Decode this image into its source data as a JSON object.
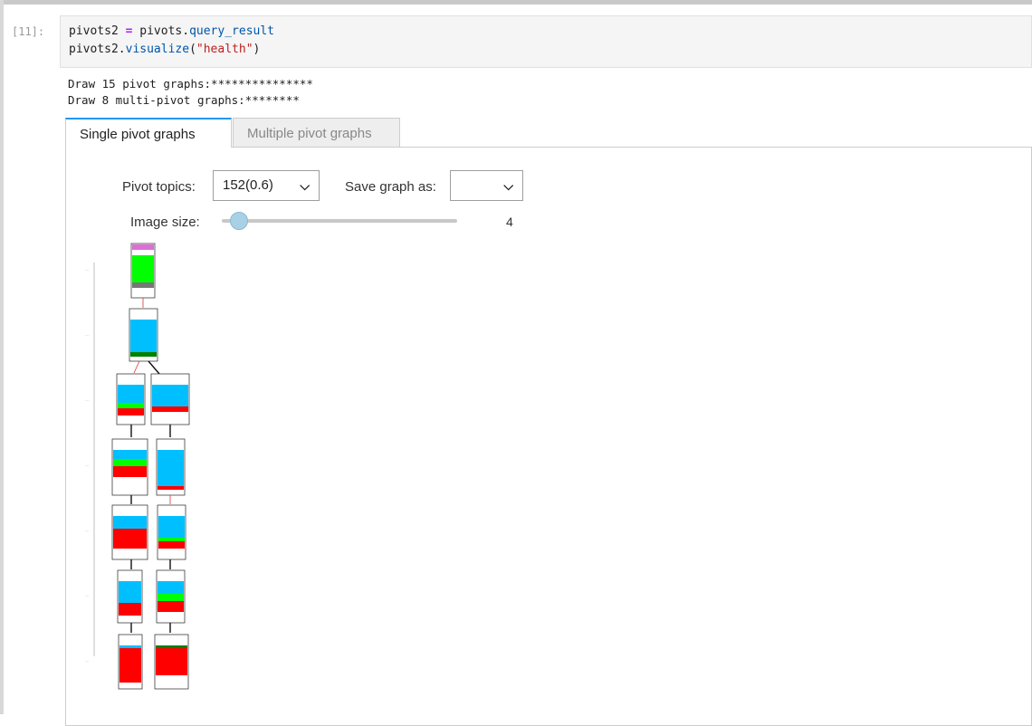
{
  "cell": {
    "prompt": "[11]:",
    "code": {
      "l1_var": "pivots2",
      "l1_eq": "=",
      "l1_obj": "pivots.",
      "l1_attr": "query_result",
      "l2_obj": "pivots2.",
      "l2_fn": "visualize",
      "l2_open": "(",
      "l2_str": "\"health\"",
      "l2_close": ")"
    }
  },
  "output": {
    "line1": "Draw 15 pivot graphs:***************",
    "line2": "Draw 8 multi-pivot graphs:********"
  },
  "tabs": [
    {
      "label": "Single pivot graphs",
      "active": true
    },
    {
      "label": "Multiple pivot graphs",
      "active": false
    }
  ],
  "controls": {
    "pivot_topics_label": "Pivot topics:",
    "pivot_topics_value": "152(0.6)",
    "save_graph_label": "Save graph as:",
    "save_graph_value": "",
    "image_size_label": "Image size:",
    "image_size_value": "4"
  },
  "colors": {
    "tab_accent": "#2196f3",
    "node_green": "#00ff00",
    "node_blue": "#00bfff",
    "node_red": "#ff0000",
    "node_purple": "#da70d6"
  }
}
